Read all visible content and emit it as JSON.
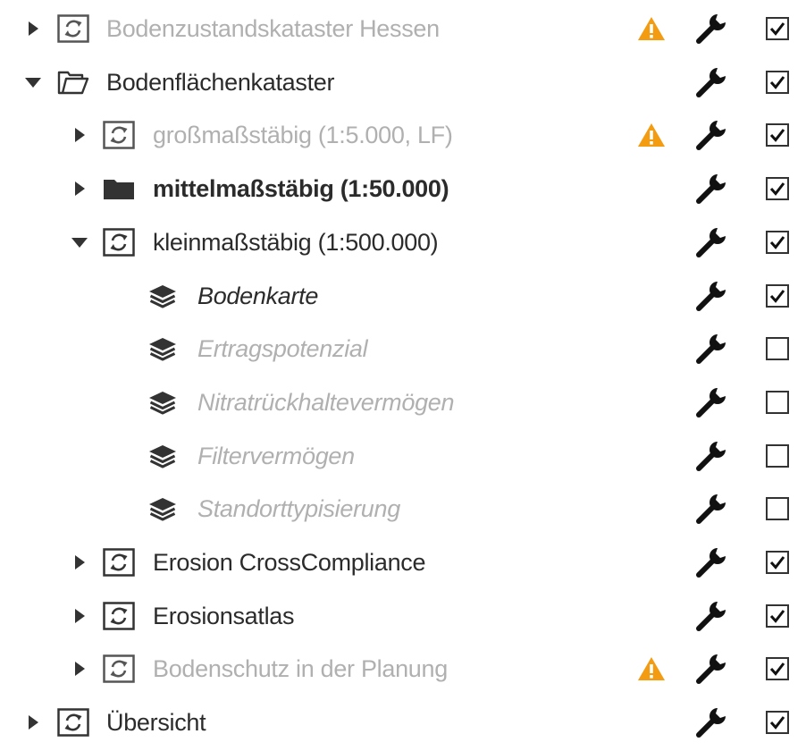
{
  "tree": {
    "items": [
      {
        "label": "Bodenzustandskataster Hessen",
        "level": 0,
        "toggle": "collapsed",
        "type": "service",
        "state": "disabled",
        "warning": true,
        "checked": true
      },
      {
        "label": "Bodenflächenkataster",
        "level": 0,
        "toggle": "expanded",
        "type": "folder-open",
        "state": "normal",
        "warning": false,
        "checked": true
      },
      {
        "label": "großmaßstäbig (1:5.000, LF)",
        "level": 1,
        "toggle": "collapsed",
        "type": "service",
        "state": "disabled",
        "warning": true,
        "checked": true
      },
      {
        "label": "mittelmaßstäbig (1:50.000)",
        "level": 1,
        "toggle": "collapsed",
        "type": "folder-closed",
        "state": "bold",
        "warning": false,
        "checked": true
      },
      {
        "label": "kleinmaßstäbig (1:500.000)",
        "level": 1,
        "toggle": "expanded",
        "type": "service",
        "state": "normal",
        "warning": false,
        "checked": true
      },
      {
        "label": "Bodenkarte",
        "level": 2,
        "toggle": "none",
        "type": "layer",
        "state": "italic",
        "warning": false,
        "checked": true
      },
      {
        "label": "Ertragspotenzial",
        "level": 2,
        "toggle": "none",
        "type": "layer",
        "state": "italic-disabled",
        "warning": false,
        "checked": false
      },
      {
        "label": "Nitratrückhaltevermögen",
        "level": 2,
        "toggle": "none",
        "type": "layer",
        "state": "italic-disabled",
        "warning": false,
        "checked": false
      },
      {
        "label": "Filtervermögen",
        "level": 2,
        "toggle": "none",
        "type": "layer",
        "state": "italic-disabled",
        "warning": false,
        "checked": false
      },
      {
        "label": "Standorttypisierung",
        "level": 2,
        "toggle": "none",
        "type": "layer",
        "state": "italic-disabled",
        "warning": false,
        "checked": false
      },
      {
        "label": "Erosion CrossCompliance",
        "level": 1,
        "toggle": "collapsed",
        "type": "service",
        "state": "normal",
        "warning": false,
        "checked": true
      },
      {
        "label": "Erosionsatlas",
        "level": 1,
        "toggle": "collapsed",
        "type": "service",
        "state": "normal",
        "warning": false,
        "checked": true
      },
      {
        "label": "Bodenschutz in der Planung",
        "level": 1,
        "toggle": "collapsed",
        "type": "service",
        "state": "disabled",
        "warning": true,
        "checked": true
      },
      {
        "label": "Übersicht",
        "level": 0,
        "toggle": "collapsed",
        "type": "service",
        "state": "normal",
        "warning": false,
        "checked": true
      }
    ]
  },
  "colors": {
    "text": "#2b2b2b",
    "text_disabled": "#b0b0b0",
    "icon": "#333333",
    "warning": "#f39c12",
    "icon_disabled": "#555555"
  }
}
